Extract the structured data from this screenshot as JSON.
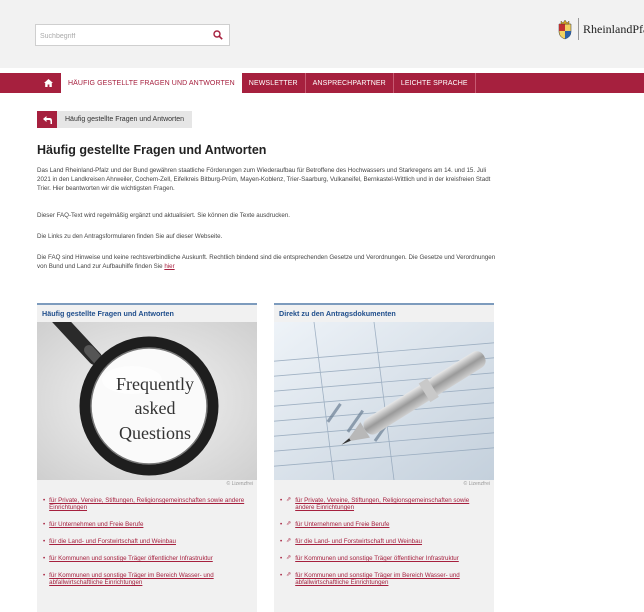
{
  "search": {
    "placeholder": "Suchbegriff"
  },
  "logo": {
    "text": "RheinlandPfa"
  },
  "nav": {
    "items": [
      {
        "label": "HÄUFIG GESTELLTE FRAGEN UND ANTWORTEN",
        "active": true
      },
      {
        "label": "NEWSLETTER"
      },
      {
        "label": "ANSPRECHPARTNER"
      },
      {
        "label": "LEICHTE SPRACHE"
      }
    ]
  },
  "breadcrumb": {
    "label": "Häufig gestellte Fragen und Antworten"
  },
  "page": {
    "title": "Häufig gestellte Fragen und Antworten",
    "p1": "Das Land Rheinland-Pfalz und der Bund gewähren staatliche Förderungen zum Wiederaufbau für Betroffene des Hochwassers und Starkregens am 14. und 15. Juli 2021 in den Landkreisen Ahrweiler, Cochem-Zell, Eifelkreis Bitburg-Prüm, Mayen-Koblenz, Trier-Saarburg, Vulkaneifel, Bernkastel-Wittlich und in der kreisfreien Stadt Trier. Hier beantworten wir die wichtigsten Fragen.",
    "p2": "Dieser FAQ-Text wird regelmäßig ergänzt und aktualisiert. Sie können die Texte ausdrucken.",
    "p3": "Die Links zu den Antragsformularen finden Sie auf dieser Webseite.",
    "p4": "Die FAQ sind Hinweise und keine rechtsverbindliche Auskunft. Rechtlich bindend sind die entsprechenden Gesetze und Verordnungen. Die Gesetze und Verordnungen von Bund und Land zur Aufbauhilfe finden Sie",
    "p4_link": "hier"
  },
  "cards": [
    {
      "title": "Häufig gestellte Fragen und Antworten",
      "image_text": [
        "Frequently",
        "asked",
        "Questions"
      ],
      "credit": "© Lizenzfrei",
      "links": [
        "für Private, Vereine, Stiftungen, Religionsgemeinschaften sowie andere Einrichtungen",
        "für Unternehmen und Freie Berufe",
        "für die Land- und Forstwirtschaft und Weinbau",
        "für Kommunen und sonstige Träger öffentlicher Infrastruktur",
        "für Kommunen und sonstige Träger im Bereich Wasser- und abfallwirtschaftliche Einrichtungen"
      ]
    },
    {
      "title": "Direkt zu den Antragsdokumenten",
      "credit": "© Lizenzfrei",
      "links": [
        "für Private, Vereine, Stiftungen, Religionsgemeinschaften sowie andere Einrichtungen",
        "für Unternehmen und Freie Berufe",
        "für die Land- und Forstwirtschaft und Weinbau",
        "für Kommunen und sonstige Träger öffentlicher Infrastruktur",
        "für Kommunen und sonstige Träger im Bereich Wasser- und abfallwirtschaftliche Einrichtungen"
      ]
    }
  ],
  "icons": {
    "search": "search-icon",
    "home": "home-icon",
    "back": "back-arrow-icon",
    "external": "external-link-icon",
    "crest": "coat-of-arms-icon"
  },
  "colors": {
    "brand": "#a6203e",
    "card_title": "#1f4e8c",
    "card_border": "#7d9bbd"
  }
}
